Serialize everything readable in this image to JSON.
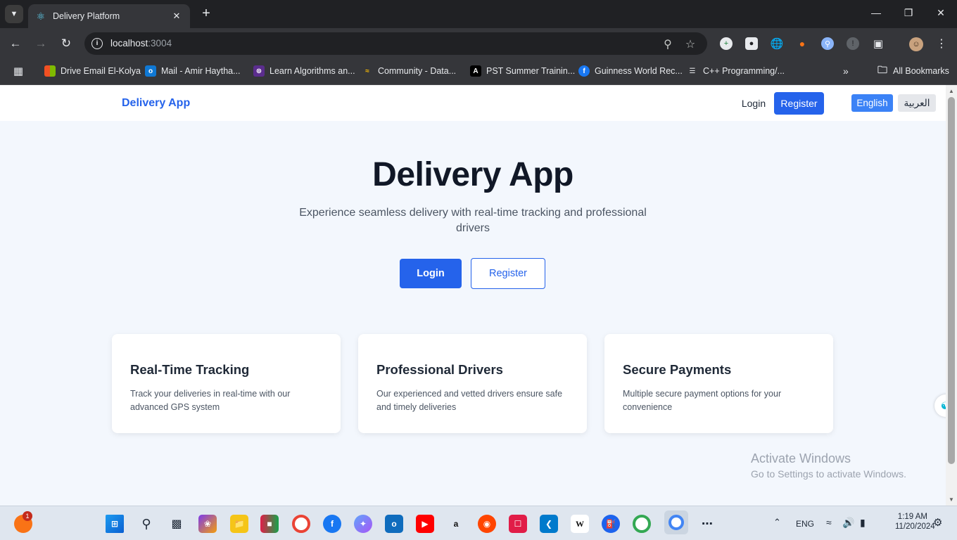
{
  "browser": {
    "tab_title": "Delivery Platform",
    "url_host": "localhost",
    "url_port": ":3004",
    "bookmarks": [
      {
        "label": "Drive Email El-Kolya",
        "icon": "microsoft-icon"
      },
      {
        "label": "Mail - Amir Haytha...",
        "icon": "outlook-icon"
      },
      {
        "label": "Learn Algorithms an...",
        "icon": "algorithms-icon"
      },
      {
        "label": "Community - Data...",
        "icon": "community-icon"
      },
      {
        "label": "PST Summer Trainin...",
        "icon": "pst-icon"
      },
      {
        "label": "Guinness World Rec...",
        "icon": "facebook-icon"
      },
      {
        "label": "C++ Programming/...",
        "icon": "wikibooks-icon"
      }
    ],
    "all_bookmarks": "All Bookmarks"
  },
  "navbar": {
    "brand": "Delivery App",
    "login": "Login",
    "register": "Register",
    "lang_en": "English",
    "lang_ar": "العربية"
  },
  "hero": {
    "title": "Delivery App",
    "subtitle": "Experience seamless delivery with real-time tracking and professional drivers",
    "login": "Login",
    "register": "Register"
  },
  "features": [
    {
      "title": "Real-Time Tracking",
      "description": "Track your deliveries in real-time with our advanced GPS system"
    },
    {
      "title": "Professional Drivers",
      "description": "Our experienced and vetted drivers ensure safe and timely deliveries"
    },
    {
      "title": "Secure Payments",
      "description": "Multiple secure payment options for your convenience"
    }
  ],
  "watermark": {
    "line1": "Activate Windows",
    "line2": "Go to Settings to activate Windows."
  },
  "taskbar": {
    "notification_count": "1",
    "language": "ENG",
    "time": "1:19 AM",
    "date": "11/20/2024"
  }
}
